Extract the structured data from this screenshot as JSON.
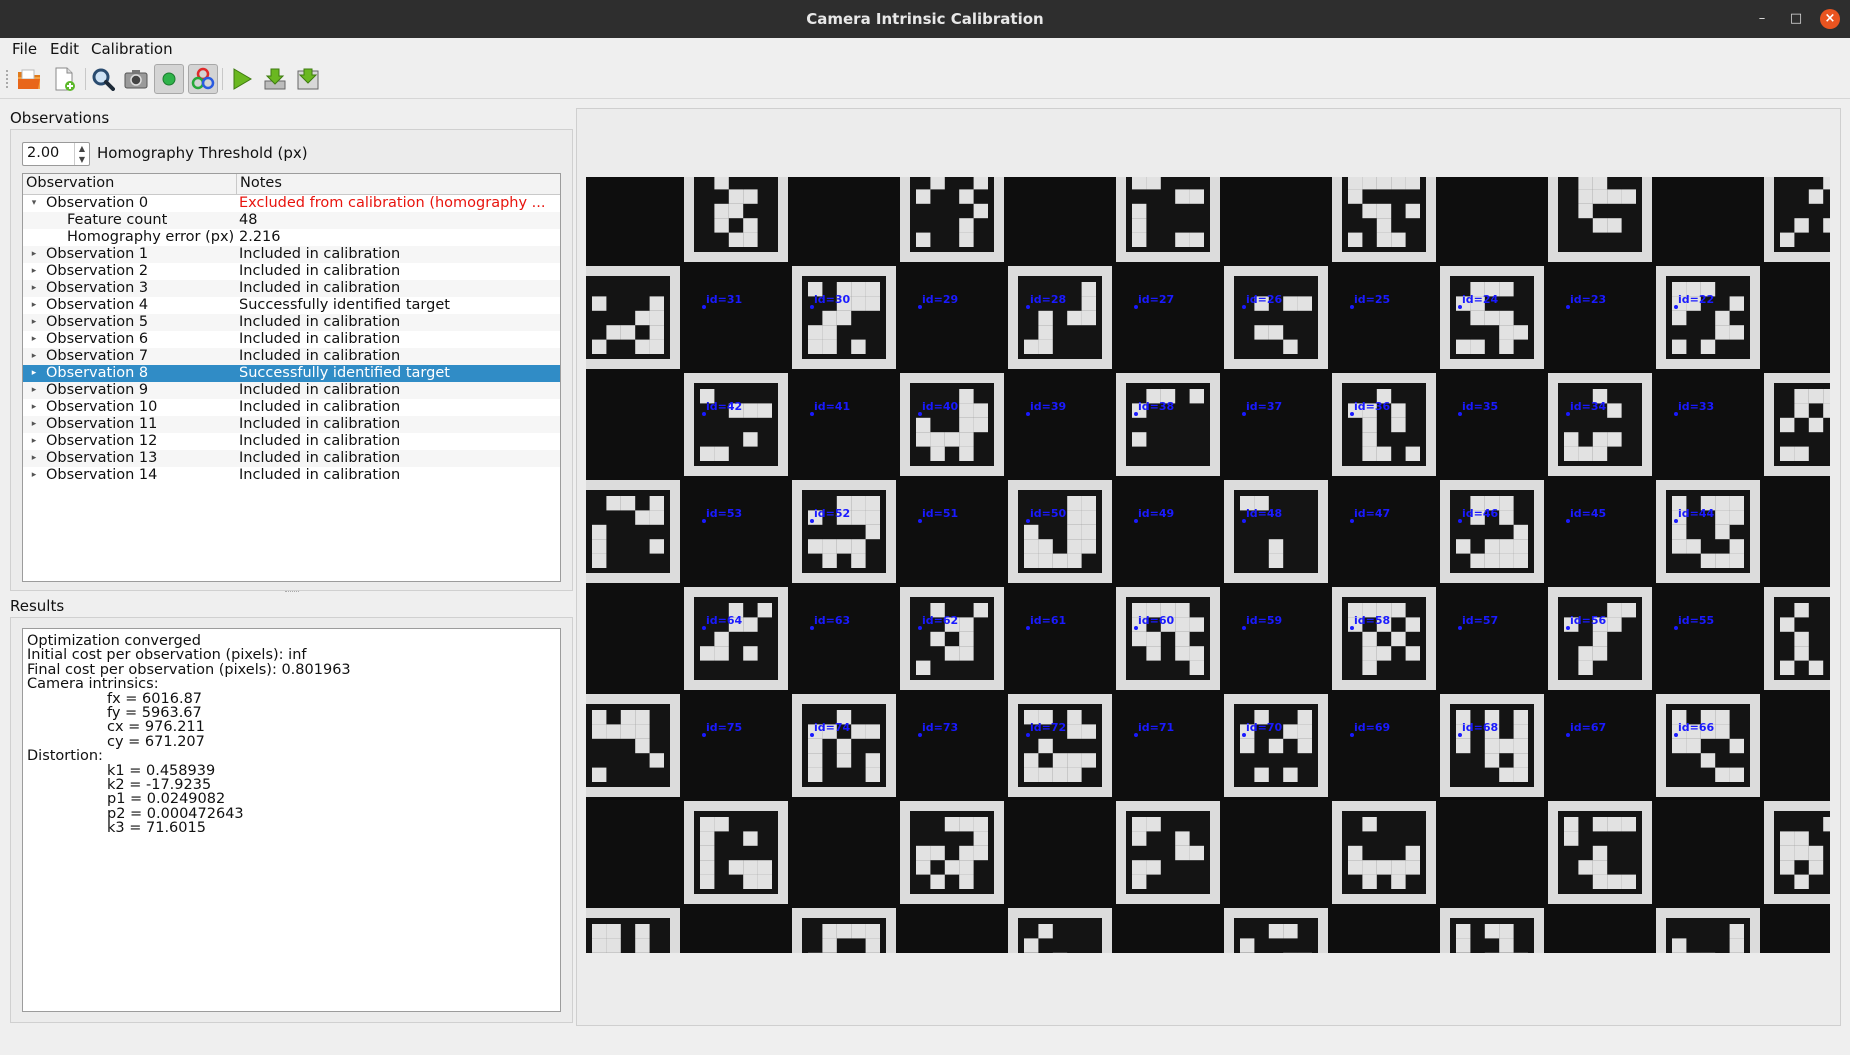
{
  "window": {
    "title": "Camera Intrinsic Calibration"
  },
  "menu": [
    "File",
    "Edit",
    "Calibration"
  ],
  "toolbar": [
    {
      "icon": "open-folder-icon",
      "active": false
    },
    {
      "icon": "new-file-icon",
      "active": false
    },
    {
      "icon": "magnifier-icon",
      "active": false
    },
    {
      "icon": "camera-icon",
      "active": false
    },
    {
      "icon": "green-dot-icon",
      "active": true
    },
    {
      "icon": "color-circles-icon",
      "active": true
    },
    {
      "icon": "play-icon",
      "active": false
    },
    {
      "icon": "download-icon",
      "active": false
    },
    {
      "icon": "download-tray-icon",
      "active": false
    }
  ],
  "observations": {
    "label": "Observations",
    "threshold_value": "2.00",
    "threshold_label": "Homography Threshold (px)",
    "columns": [
      "Observation",
      "Notes"
    ],
    "rows": [
      {
        "name": "Observation 0",
        "note": "Excluded from calibration (homography ...",
        "expanded": true,
        "red": true
      },
      {
        "name": "Feature count",
        "note": "48",
        "child": true
      },
      {
        "name": "Homography error (px)",
        "note": "2.216",
        "child": true
      },
      {
        "name": "Observation 1",
        "note": "Included in calibration"
      },
      {
        "name": "Observation 2",
        "note": "Included in calibration"
      },
      {
        "name": "Observation 3",
        "note": "Included in calibration"
      },
      {
        "name": "Observation 4",
        "note": "Successfully identified target"
      },
      {
        "name": "Observation 5",
        "note": "Included in calibration"
      },
      {
        "name": "Observation 6",
        "note": "Included in calibration"
      },
      {
        "name": "Observation 7",
        "note": "Included in calibration"
      },
      {
        "name": "Observation 8",
        "note": "Successfully identified target",
        "selected": true
      },
      {
        "name": "Observation 9",
        "note": "Included in calibration"
      },
      {
        "name": "Observation 10",
        "note": "Included in calibration"
      },
      {
        "name": "Observation 11",
        "note": "Included in calibration"
      },
      {
        "name": "Observation 12",
        "note": "Included in calibration"
      },
      {
        "name": "Observation 13",
        "note": "Included in calibration"
      },
      {
        "name": "Observation 14",
        "note": "Included in calibration"
      }
    ]
  },
  "results": {
    "label": "Results",
    "lines": [
      {
        "text": "Optimization converged",
        "indent": false
      },
      {
        "text": "Initial cost per observation (pixels): inf",
        "indent": false
      },
      {
        "text": "Final cost per observation (pixels): 0.801963",
        "indent": false
      },
      {
        "text": "Camera intrinsics:",
        "indent": false
      },
      {
        "text": "fx = 6016.87",
        "indent": true
      },
      {
        "text": "fy = 5963.67",
        "indent": true
      },
      {
        "text": "cx = 976.211",
        "indent": true
      },
      {
        "text": "cy = 671.207",
        "indent": true
      },
      {
        "text": "Distortion:",
        "indent": false
      },
      {
        "text": "k1 = 0.458939",
        "indent": true
      },
      {
        "text": "k2 = -17.9235",
        "indent": true
      },
      {
        "text": "p1 = 0.0249082",
        "indent": true
      },
      {
        "text": "p2 = 0.000472643",
        "indent": true
      },
      {
        "text": "k3 = 71.6015",
        "indent": true
      }
    ]
  },
  "board": {
    "tag_rows": [
      [
        "id=31",
        "id=30",
        "id=29",
        "id=28",
        "id=27",
        "id=26",
        "id=25",
        "id=24",
        "id=23",
        "id=22"
      ],
      [
        "id=42",
        "id=41",
        "id=40",
        "id=39",
        "id=38",
        "id=37",
        "id=36",
        "id=35",
        "id=34",
        "id=33"
      ],
      [
        "id=53",
        "id=52",
        "id=51",
        "id=50",
        "id=49",
        "id=48",
        "id=47",
        "id=46",
        "id=45",
        "id=44"
      ],
      [
        "id=64",
        "id=63",
        "id=62",
        "id=61",
        "id=60",
        "id=59",
        "id=58",
        "id=57",
        "id=56",
        "id=55"
      ],
      [
        "id=75",
        "id=74",
        "id=73",
        "id=72",
        "id=71",
        "id=70",
        "id=69",
        "id=68",
        "id=67",
        "id=66"
      ]
    ],
    "label_color": "#1a1aff",
    "background": "#0e0e0e"
  }
}
